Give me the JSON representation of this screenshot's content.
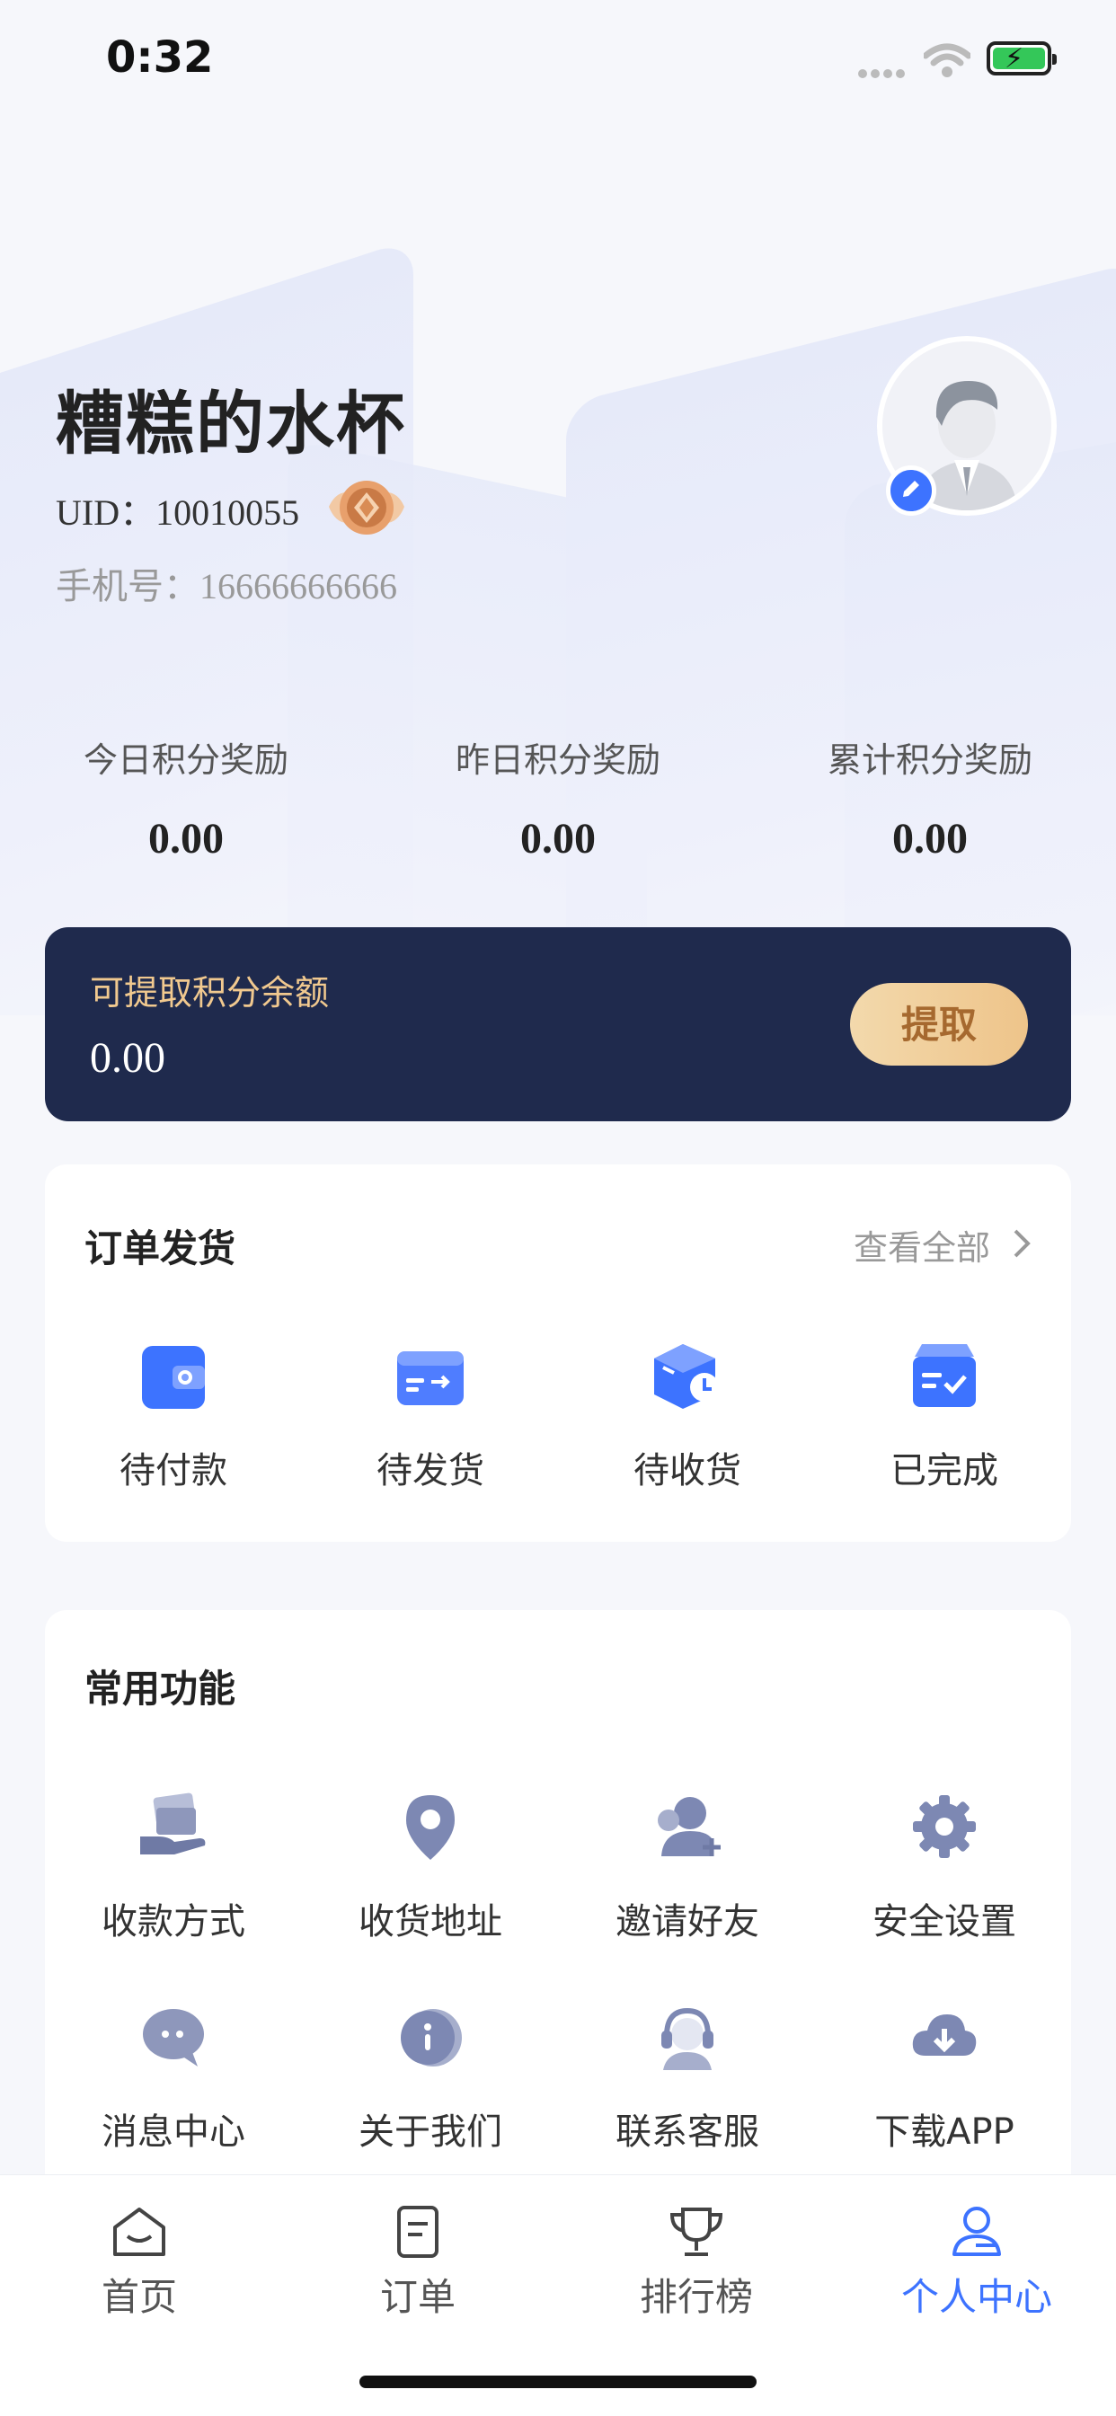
{
  "status_bar": {
    "time": "0:32"
  },
  "user": {
    "name": "糟糕的水杯",
    "uid_label": "UID：",
    "uid_value": "10010055",
    "phone_label": "手机号：",
    "phone_value": "16666666666"
  },
  "stats": [
    {
      "label": "今日积分奖励",
      "value": "0.00"
    },
    {
      "label": "昨日积分奖励",
      "value": "0.00"
    },
    {
      "label": "累计积分奖励",
      "value": "0.00"
    }
  ],
  "balance": {
    "title": "可提取积分余额",
    "value": "0.00",
    "button": "提取"
  },
  "orders": {
    "title": "订单发货",
    "view_all": "查看全部",
    "items": [
      {
        "label": "待付款",
        "icon": "wallet-icon"
      },
      {
        "label": "待发货",
        "icon": "shipping-card-icon"
      },
      {
        "label": "待收货",
        "icon": "box-clock-icon"
      },
      {
        "label": "已完成",
        "icon": "box-check-icon"
      }
    ]
  },
  "functions": {
    "title": "常用功能",
    "items": [
      {
        "label": "收款方式",
        "icon": "cash-hand-icon"
      },
      {
        "label": "收货地址",
        "icon": "location-pin-icon"
      },
      {
        "label": "邀请好友",
        "icon": "add-friend-icon"
      },
      {
        "label": "安全设置",
        "icon": "gear-icon"
      },
      {
        "label": "消息中心",
        "icon": "chat-bubble-icon"
      },
      {
        "label": "关于我们",
        "icon": "info-icon"
      },
      {
        "label": "联系客服",
        "icon": "headset-icon"
      },
      {
        "label": "下载APP",
        "icon": "cloud-download-icon"
      }
    ]
  },
  "tabbar": [
    {
      "label": "首页",
      "icon": "home-icon"
    },
    {
      "label": "订单",
      "icon": "order-doc-icon"
    },
    {
      "label": "排行榜",
      "icon": "trophy-icon"
    },
    {
      "label": "个人中心",
      "icon": "profile-icon"
    }
  ],
  "colors": {
    "accent": "#3d73ff",
    "card_dark": "#1f2a4d",
    "gold": "#f1c98f"
  }
}
